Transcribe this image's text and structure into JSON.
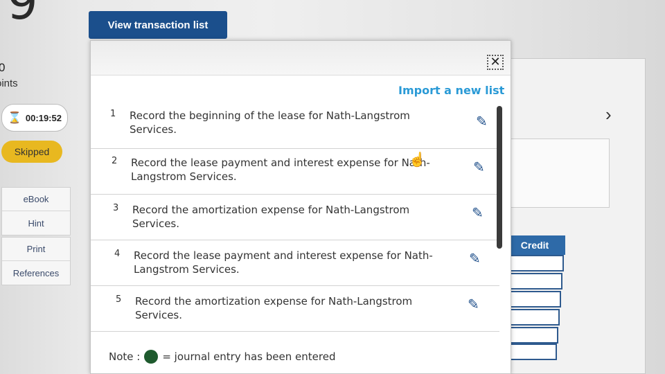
{
  "left_panel": {
    "big_number": "9",
    "points_value": "0",
    "points_label": "oints",
    "timer": "00:19:52",
    "skipped_label": "Skipped",
    "resources": [
      "eBook",
      "Hint",
      "Print",
      "References"
    ]
  },
  "view_transaction_button": "View transaction list",
  "modal": {
    "close_label": "✕",
    "import_link": "Import a new list",
    "rows": [
      {
        "num": "1",
        "text": "Record the beginning of the lease for Nath-Langstrom Services."
      },
      {
        "num": "2",
        "text": "Record the lease payment and interest expense for Nath-Langstrom Services."
      },
      {
        "num": "3",
        "text": "Record the amortization expense for Nath-Langstrom Services."
      },
      {
        "num": "4",
        "text": "Record the lease payment and interest expense for Nath-Langstrom Services."
      },
      {
        "num": "5",
        "text": "Record the amortization expense for Nath-Langstrom Services."
      }
    ],
    "note_prefix": "Note :",
    "note_suffix": "= journal entry has been entered",
    "note_dot_color": "#1e5a2e"
  },
  "background": {
    "credit_header": "Credit",
    "next_chevron": "›"
  },
  "colors": {
    "primary_button": "#1b4f8c",
    "link": "#2a9ad6",
    "skipped_badge": "#e8b820",
    "credit_header": "#2e6aa8"
  }
}
